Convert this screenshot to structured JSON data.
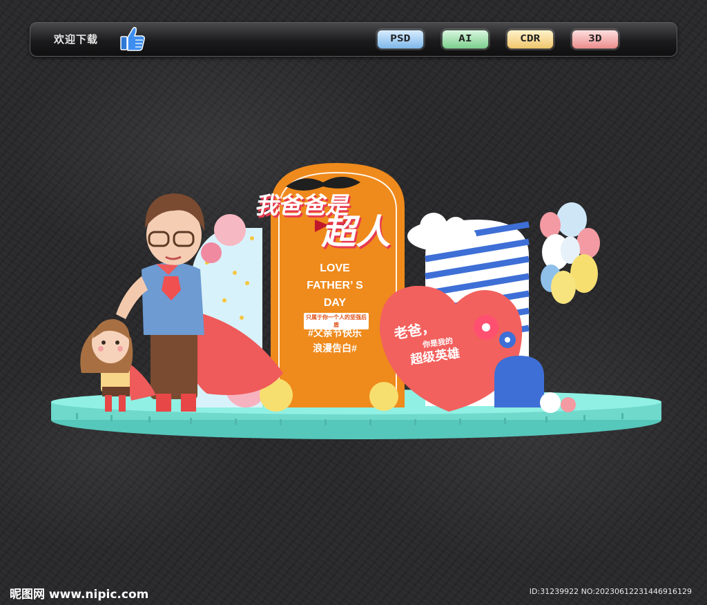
{
  "toolbar": {
    "welcome_label": "欢迎下载",
    "thumb_icon": "thumbs-up-icon",
    "formats": [
      {
        "label": "PSD",
        "color": "#8fc3ef"
      },
      {
        "label": "AI",
        "color": "#8fd49e"
      },
      {
        "label": "CDR",
        "color": "#f2cc7a"
      },
      {
        "label": "3D",
        "color": "#ee9898"
      }
    ]
  },
  "poster": {
    "headline_line1": "我爸爸是",
    "headline_line2": "超人",
    "en_line1": "LOVE",
    "en_line2": "FATHER’ S",
    "en_line3": "DAY",
    "tagline_small": "只属于你一个人的坚强后盾",
    "hashtag_line1": "#父亲节快乐",
    "hashtag_line2": "浪漫告白#",
    "heart_line1": "老爸，",
    "heart_line2": "你是我的",
    "heart_line3": "超级英雄"
  },
  "footer": {
    "watermark": "昵图网 www.nipic.com",
    "id_text": "ID:31239922 NO:20230612231446916129"
  },
  "colors": {
    "orange_panel": "#ef8a1c",
    "platform": "#7fe3d6",
    "heart": "#f2615e",
    "stripe_blue": "#3e6fd6"
  }
}
